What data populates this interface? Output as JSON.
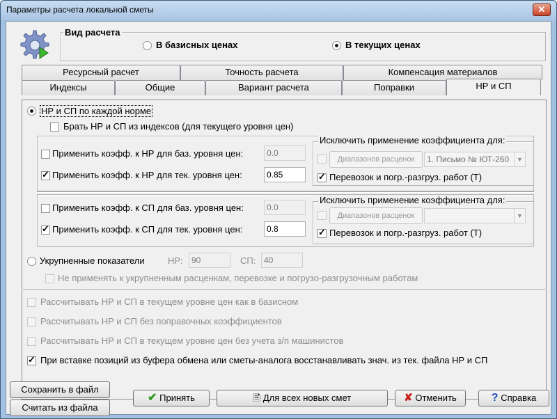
{
  "window": {
    "title": "Параметры расчета локальной сметы",
    "close_glyph": "✕"
  },
  "calc_type": {
    "title": "Вид расчета",
    "base_prices_label": "В базисных ценах",
    "current_prices_label": "В текущих ценах",
    "selected": "current"
  },
  "tabs_back": [
    "Ресурсный расчет",
    "Точность расчета",
    "Компенсация материалов"
  ],
  "tabs_front": [
    "Индексы",
    "Общие",
    "Вариант расчета",
    "Поправки",
    "НР и СП"
  ],
  "active_tab": "НР и СП",
  "per_norm": {
    "label": "НР и СП по каждой норме",
    "from_indexes_label": "Брать НР и СП из индексов (для текущего уровня цен)",
    "from_indexes_checked": false
  },
  "nr_group": {
    "base_label": "Применить коэфф. к НР для баз. уровня цен:",
    "base_checked": false,
    "base_value": "0.0",
    "cur_label": "Применить коэфф. к НР для тек. уровня цен:",
    "cur_checked": true,
    "cur_value": "0.85",
    "exclude_title": "Исключить применение коэффициента для:",
    "ranges_button": "Диапазонов расценок",
    "ranges_select": "1. Письмо № ЮТ-260",
    "transport_label": "Перевозок и погр.-разгруз. работ (Т)",
    "transport_checked": true
  },
  "sp_group": {
    "base_label": "Применить коэфф. к СП для баз. уровня цен:",
    "base_checked": false,
    "base_value": "0.0",
    "cur_label": "Применить коэфф. к СП для тек. уровня цен:",
    "cur_checked": true,
    "cur_value": "0.8",
    "exclude_title": "Исключить применение коэффициента для:",
    "ranges_button": "Диапазонов расценок",
    "ranges_select": "",
    "transport_label": "Перевозок и погр.-разгруз. работ (Т)",
    "transport_checked": true
  },
  "aggregated": {
    "label": "Укрупненные показатели",
    "nr_label": "НР:",
    "nr_value": "90",
    "sp_label": "СП:",
    "sp_value": "40",
    "not_apply_label": "Не применять к укрупненным расценкам, перевозке и погрузо-разгрузочным работам"
  },
  "options": [
    {
      "label": "Рассчитывать НР и СП в текущем уровне цен как в базисном",
      "checked": false,
      "enabled": false
    },
    {
      "label": "Рассчитывать НР и СП без поправочных коэффициентов",
      "checked": false,
      "enabled": false
    },
    {
      "label": "Рассчитывать НР и СП в текущем уровне цен без учета з/п машинистов",
      "checked": false,
      "enabled": false
    },
    {
      "label": "При вставке позиций из буфера обмена или сметы-аналога восстанавливать знач. из тек. файла НР и СП",
      "checked": true,
      "enabled": true
    }
  ],
  "buttons": {
    "save_file": "Сохранить в файл",
    "load_file": "Считать из файла",
    "accept": "Принять",
    "all_new": "Для всех новых смет",
    "cancel": "Отменить",
    "help": "Справка"
  },
  "colors": {
    "accept_icon": "#2e9a1e",
    "cancel_icon": "#c8201a",
    "help_icon": "#1d4fb3",
    "gear": "#7f93c8"
  }
}
